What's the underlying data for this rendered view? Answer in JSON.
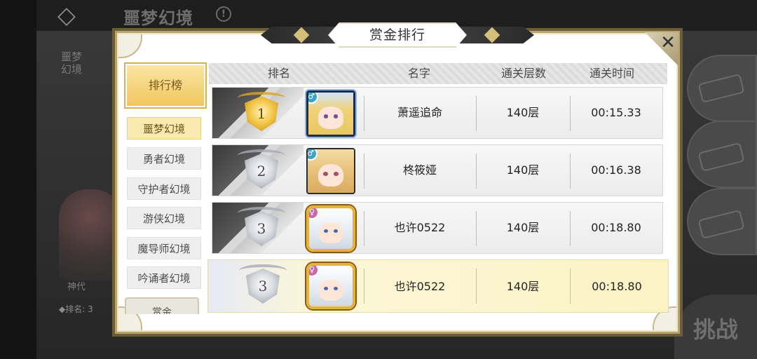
{
  "background": {
    "title": "噩梦幻境",
    "side_tab": "噩梦\n幻境",
    "char_label": "神代",
    "rank_label": "◆排名: 3",
    "challenge_label": "挑战"
  },
  "modal": {
    "title": "赏金排行",
    "close": "✕"
  },
  "nav": {
    "main_label": "排行榜",
    "items": [
      {
        "label": "噩梦幻境",
        "active": true
      },
      {
        "label": "勇者幻境",
        "active": false
      },
      {
        "label": "守护者幻境",
        "active": false
      },
      {
        "label": "游侠幻境",
        "active": false
      },
      {
        "label": "魔导师幻境",
        "active": false
      },
      {
        "label": "吟诵者幻境",
        "active": false
      }
    ],
    "bottom_label": "赏金"
  },
  "table": {
    "headers": {
      "rank": "排名",
      "name": "名字",
      "floor": "通关层数",
      "time": "通关时间"
    },
    "rows": [
      {
        "rank": "1",
        "medal": "gold",
        "name": "萧遥追命",
        "floor": "140层",
        "time": "00:15.33",
        "avatar": "glasses-girl",
        "zodiac": "♂"
      },
      {
        "rank": "2",
        "medal": "silver",
        "name": "柊筱娅",
        "floor": "140层",
        "time": "00:16.38",
        "avatar": "blonde-girl",
        "zodiac": "♂"
      },
      {
        "rank": "3",
        "medal": "silver",
        "name": "也许0522",
        "floor": "140层",
        "time": "00:18.80",
        "avatar": "white-hair",
        "zodiac": "♀"
      }
    ],
    "my_row": {
      "rank": "3",
      "medal": "silver",
      "name": "也许0522",
      "floor": "140层",
      "time": "00:18.80",
      "avatar": "white-hair",
      "zodiac": "♀"
    }
  },
  "colors": {
    "accent_gold": "#f0c45c",
    "frame_gold": "#b8a36a",
    "my_row_bg": "#fcf3c4"
  }
}
